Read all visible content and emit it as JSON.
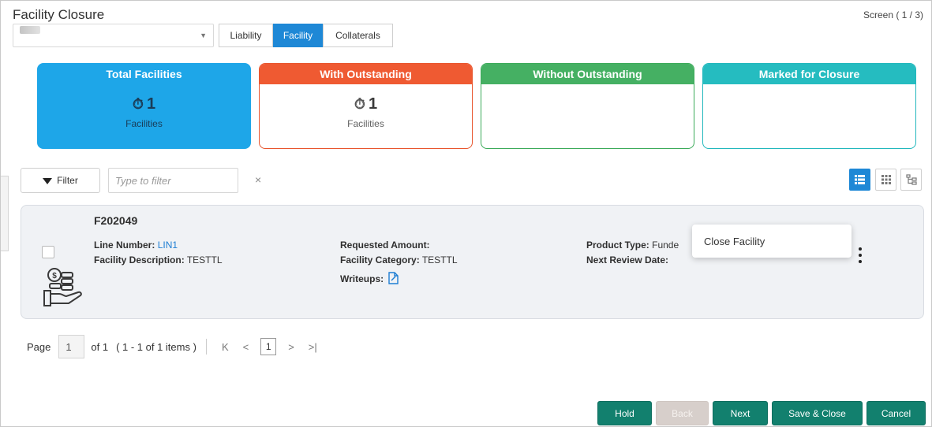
{
  "header": {
    "title": "Facility Closure",
    "screen_indicator": "Screen ( 1 / 3)"
  },
  "segments": {
    "tabs": [
      {
        "label": "Liability",
        "active": false
      },
      {
        "label": "Facility",
        "active": true
      },
      {
        "label": "Collaterals",
        "active": false
      }
    ]
  },
  "summary_cards": [
    {
      "title": "Total Facilities",
      "count": "1",
      "unit": "Facilities",
      "color": "#1ea6e8"
    },
    {
      "title": "With Outstanding",
      "count": "1",
      "unit": "Facilities",
      "color": "#ef5a32"
    },
    {
      "title": "Without Outstanding",
      "count": "",
      "unit": "",
      "color": "#45b063"
    },
    {
      "title": "Marked for Closure",
      "count": "",
      "unit": "",
      "color": "#25bcc0"
    }
  ],
  "filter": {
    "button_label": "Filter",
    "placeholder": "Type to filter",
    "clear_symbol": "×"
  },
  "record": {
    "id": "F202049",
    "line_number_label": "Line Number:",
    "line_number_value": "LIN1",
    "facility_description_label": "Facility Description:",
    "facility_description_value": "TESTTL",
    "requested_amount_label": "Requested Amount:",
    "facility_category_label": "Facility Category:",
    "facility_category_value": "TESTTL",
    "writeups_label": "Writeups:",
    "product_type_label": "Product Type:",
    "product_type_value": "Funde",
    "next_review_date_label": "Next Review Date:"
  },
  "context_menu": {
    "items": [
      "Close Facility"
    ]
  },
  "pagination": {
    "page_label": "Page",
    "page_value": "1",
    "of_label": "of 1",
    "items_summary": "( 1 - 1 of 1 items )",
    "first_symbol": "K",
    "prev_symbol": "<",
    "current_page": "1",
    "next_symbol": ">",
    "last_symbol": ">|"
  },
  "footer": {
    "hold": "Hold",
    "back": "Back",
    "next": "Next",
    "save_close": "Save & Close",
    "cancel": "Cancel"
  }
}
